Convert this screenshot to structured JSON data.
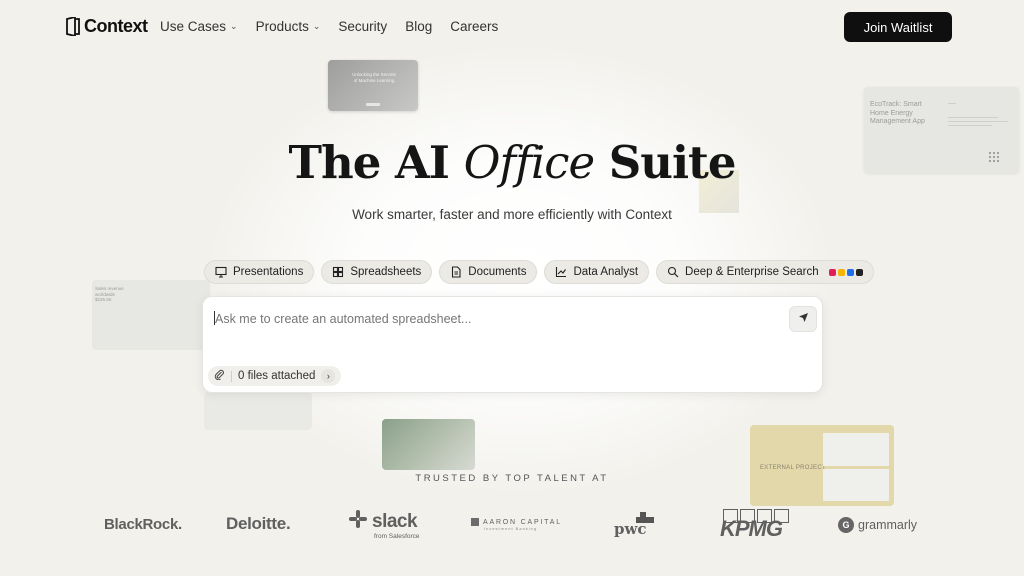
{
  "nav": {
    "logo_text": "Context",
    "links": [
      {
        "label": "Use Cases",
        "has_dropdown": true
      },
      {
        "label": "Products",
        "has_dropdown": true
      },
      {
        "label": "Security",
        "has_dropdown": false
      },
      {
        "label": "Blog",
        "has_dropdown": false
      },
      {
        "label": "Careers",
        "has_dropdown": false
      }
    ],
    "cta_label": "Join Waitlist"
  },
  "hero": {
    "title_part1": "The AI ",
    "title_italic": "Office",
    "title_part2": " Suite",
    "subtitle": "Work smarter, faster and more efficiently with Context"
  },
  "chips": [
    {
      "label": "Presentations",
      "icon": "presentation-icon"
    },
    {
      "label": "Spreadsheets",
      "icon": "spreadsheet-icon"
    },
    {
      "label": "Documents",
      "icon": "document-icon"
    },
    {
      "label": "Data Analyst",
      "icon": "chart-icon"
    },
    {
      "label": "Deep & Enterprise Search",
      "icon": "search-icon"
    }
  ],
  "prompt": {
    "placeholder": "Ask me to create an automated spreadsheet...",
    "files_label": "0 files attached"
  },
  "cards": {
    "card_a_title": "Unlocking the Secrets of Machine Learning",
    "card_b_title": "EcoTrack: Smart Home Energy Management App",
    "card_d_title": "Sales revenue worldwide $236.5K",
    "card_g_title": "EXTERNAL PROJECT"
  },
  "trusted": {
    "label": "TRUSTED BY TOP TALENT AT",
    "brands": {
      "blackrock": "BlackRock.",
      "deloitte": "Deloitte.",
      "slack": "slack",
      "slack_sub": "from Salesforce",
      "aaron": "AARON CAPITAL",
      "aaron_sub": "Investment Banking",
      "pwc": "pwc",
      "kpmg": "KPMG",
      "grammarly": "grammarly"
    }
  },
  "colors": {
    "background": "#f2f1ec",
    "cta_bg": "#0f0f0f",
    "chip_bg": "#ebeae5",
    "brand_gray": "#606060"
  }
}
